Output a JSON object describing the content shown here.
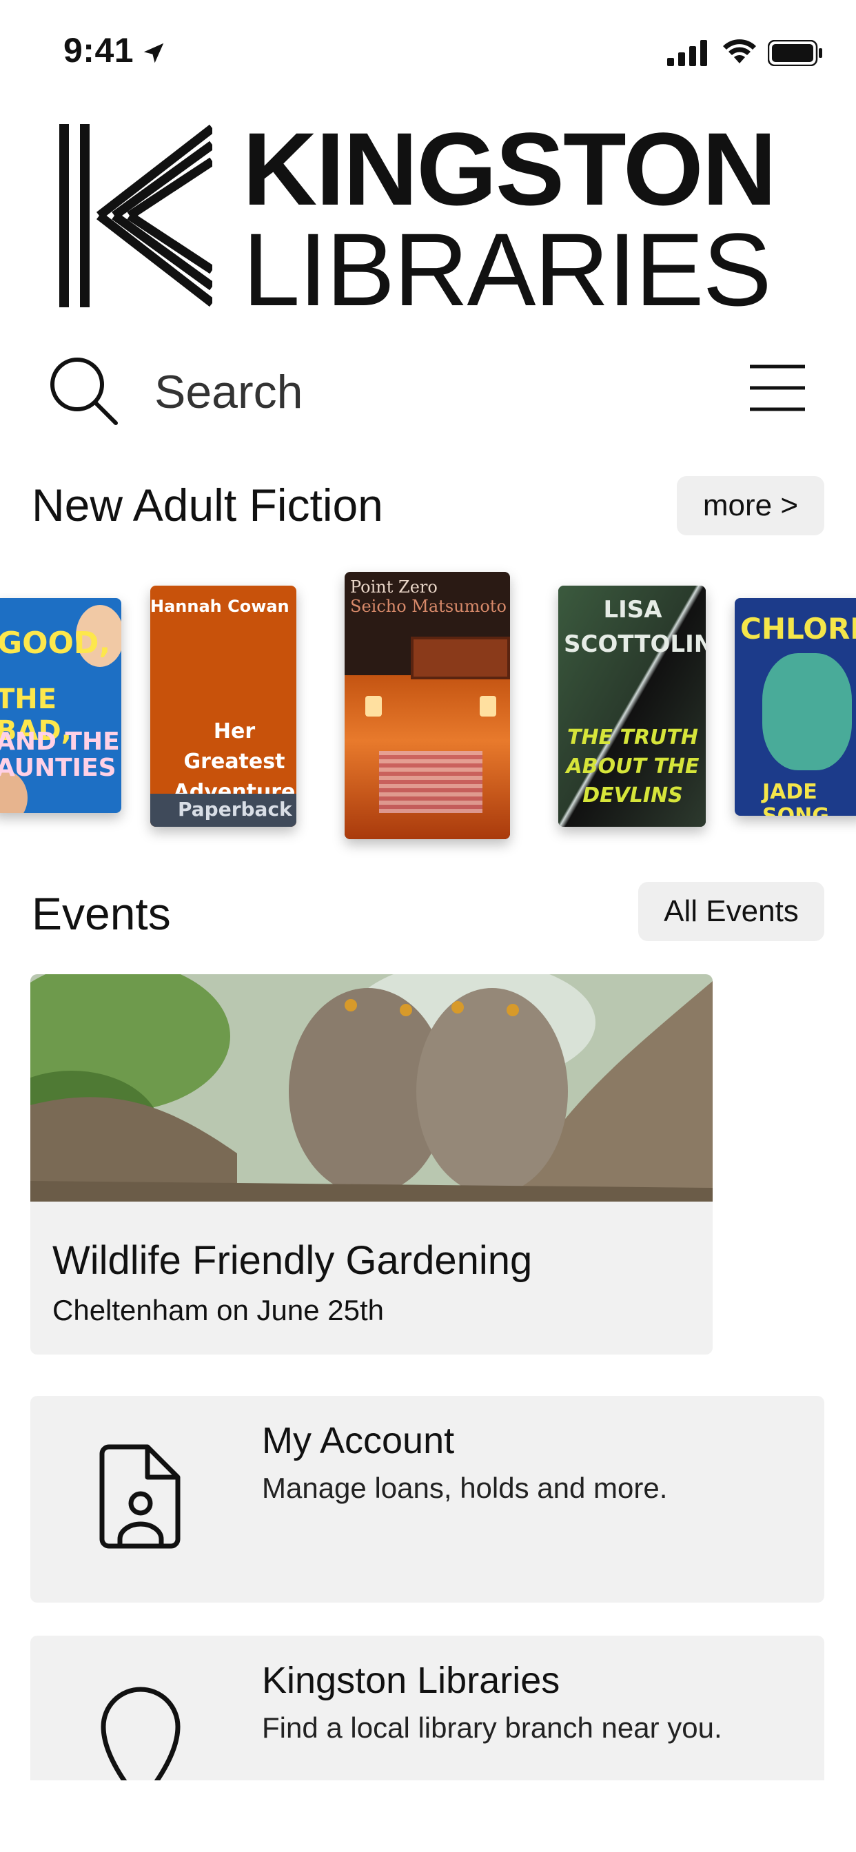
{
  "status_bar": {
    "time": "9:41",
    "icons": [
      "location-arrow-icon",
      "cellular-signal-icon",
      "wifi-icon",
      "battery-icon"
    ]
  },
  "logo": {
    "line1": "KINGSTON",
    "line2": "LIBRARIES"
  },
  "search": {
    "label": "Search"
  },
  "fiction": {
    "title": "New Adult Fiction",
    "more_label": "more >",
    "books": [
      {
        "cover_text": [
          "GOOD,",
          "THE BAD,",
          "AND THE AUNTIES"
        ]
      },
      {
        "author": "Hannah Cowan",
        "title": "Her Greatest Adventure",
        "badge": "Paperback"
      },
      {
        "title": "Point Zero",
        "author": "Seicho Matsumoto"
      },
      {
        "author": "LISA SCOTTOLINE",
        "title": "THE TRUTH ABOUT THE DEVLINS"
      },
      {
        "title": "CHLORINE",
        "author": "JADE SONG"
      }
    ]
  },
  "events": {
    "title": "Events",
    "all_label": "All Events",
    "featured": {
      "title": "Wildlife Friendly Gardening",
      "subtitle": "Cheltenham on June 25th"
    }
  },
  "cards": {
    "account": {
      "title": "My Account",
      "subtitle": "Manage loans, holds and more."
    },
    "library": {
      "title": "Kingston Libraries",
      "subtitle": "Find a local library branch near you."
    }
  },
  "colors": {
    "background": "#ffffff",
    "card": "#f1f1f1",
    "text": "#111111"
  }
}
